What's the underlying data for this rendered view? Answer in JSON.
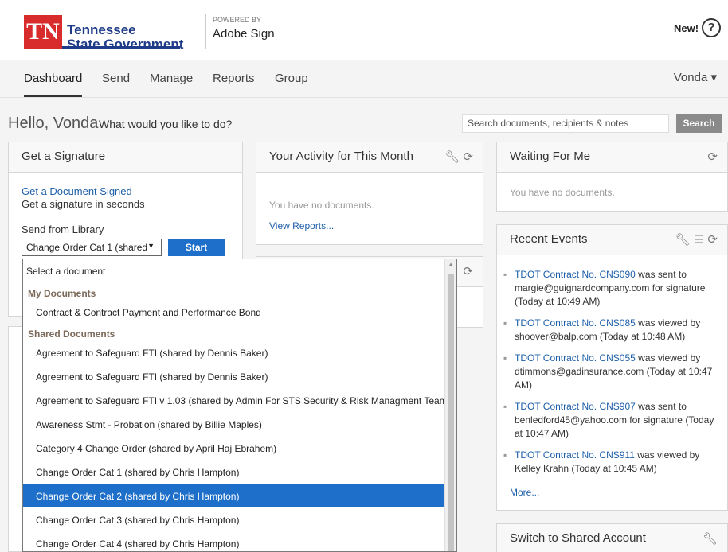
{
  "brand": {
    "tn": "TN",
    "name_line1": "Tennessee",
    "name_line2": "State Government",
    "powered_by": "POWERED BY",
    "product": "Adobe Sign",
    "new_label": "New!",
    "help_glyph": "?"
  },
  "nav": {
    "items": [
      "Dashboard",
      "Send",
      "Manage",
      "Reports",
      "Group"
    ],
    "user": "Vonda",
    "user_caret": "▾"
  },
  "greeting": {
    "hello": "Hello, Vonda",
    "question": "What would you like to do?"
  },
  "search": {
    "placeholder": "Search documents, recipients & notes",
    "button": "Search"
  },
  "get_signature": {
    "title": "Get a Signature",
    "link": "Get a Document Signed",
    "sub": "Get a signature in seconds",
    "library_label": "Send from Library",
    "selected": "Change Order Cat 1 (shared",
    "start": "Start"
  },
  "activity": {
    "title": "Your Activity for This Month",
    "empty": "You have no documents.",
    "link": "View Reports..."
  },
  "waiting": {
    "title": "Waiting For Me",
    "empty": "You have no documents."
  },
  "recent": {
    "title": "Recent Events",
    "events": [
      {
        "link": "TDOT Contract No. CNS090",
        "text": "was sent to margie@guignardcompany.com for signature (Today at 10:49 AM)"
      },
      {
        "link": "TDOT Contract No. CNS085",
        "text": "was viewed by shoover@balp.com (Today at 10:48 AM)"
      },
      {
        "link": "TDOT Contract No. CNS055",
        "text": "was viewed by dtimmons@gadinsurance.com (Today at 10:47 AM)"
      },
      {
        "link": "TDOT Contract No. CNS907",
        "text": "was sent to benledford45@yahoo.com for signature (Today at 10:47 AM)"
      },
      {
        "link": "TDOT Contract No. CNS911",
        "text": "was viewed by Kelley Krahn (Today at 10:45 AM)"
      }
    ],
    "more": "More..."
  },
  "shared_account": {
    "title": "Switch to Shared Account"
  },
  "dropdown": {
    "placeholder": "Select a document",
    "group_mine": "My Documents",
    "mine": [
      "Contract & Contract Payment and Performance Bond"
    ],
    "group_shared": "Shared Documents",
    "shared": [
      "Agreement to Safeguard FTI (shared by Dennis Baker)",
      "Agreement to Safeguard FTI (shared by Dennis Baker)",
      "Agreement to Safeguard FTI v 1.03 (shared by Admin For STS Security & Risk Managment Team )",
      "Awareness Stmt - Probation (shared by Billie Maples)",
      "Category 4 Change Order (shared by April Haj Ebrahem)",
      "Change Order Cat 1 (shared by Chris Hampton)",
      "Change Order Cat 2 (shared by Chris Hampton)",
      "Change Order Cat 3 (shared by Chris Hampton)",
      "Change Order Cat 4 (shared by Chris Hampton)"
    ],
    "highlighted_index": 6
  },
  "colors": {
    "tn_red": "#d82b2b",
    "tn_blue": "#1f3c88",
    "link_blue": "#1d5fa8",
    "highlight": "#1e6fc9"
  }
}
